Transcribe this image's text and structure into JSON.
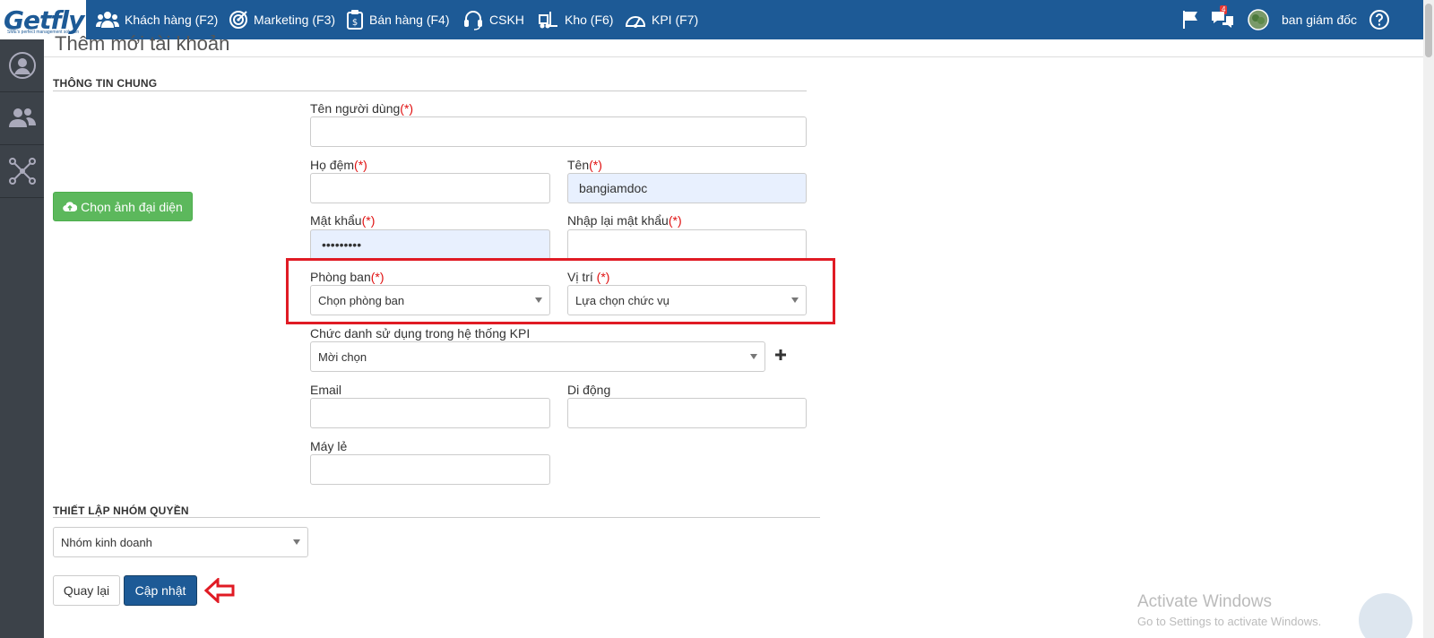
{
  "brand": {
    "name": "Getfly",
    "tagline": "SME's perfect management solution"
  },
  "nav": [
    {
      "label": "Khách hàng (F2)",
      "icon": "users-icon"
    },
    {
      "label": "Marketing (F3)",
      "icon": "target-icon"
    },
    {
      "label": "Bán hàng (F4)",
      "icon": "sales-icon"
    },
    {
      "label": "CSKH",
      "icon": "headset-icon"
    },
    {
      "label": "Kho (F6)",
      "icon": "forklift-icon"
    },
    {
      "label": "KPI (F7)",
      "icon": "speedometer-icon"
    }
  ],
  "user": {
    "name": "ban giám đốc",
    "notification_count": "4"
  },
  "page": {
    "title": "Thêm mới tài khoản"
  },
  "sections": {
    "general": "THÔNG TIN CHUNG",
    "permissions": "THIẾT LẬP NHÓM QUYỀN"
  },
  "form": {
    "required_mark": "(*)",
    "avatar_button": "Chọn ảnh đại diện",
    "username": {
      "label": "Tên người dùng",
      "value": ""
    },
    "middle_name": {
      "label": "Họ đệm",
      "value": ""
    },
    "first_name": {
      "label": "Tên",
      "value": "bangiamdoc"
    },
    "password": {
      "label": "Mật khẩu",
      "value": "•••••••••"
    },
    "confirm_password": {
      "label": "Nhập lại mật khẩu",
      "value": ""
    },
    "department": {
      "label": "Phòng ban",
      "value": "Chọn phòng ban"
    },
    "position": {
      "label": "Vị trí",
      "value": "Lựa chọn chức vụ"
    },
    "kpi_title": {
      "label": "Chức danh sử dụng trong hệ thống KPI",
      "value": "Mời chọn"
    },
    "email": {
      "label": "Email",
      "value": ""
    },
    "mobile": {
      "label": "Di động",
      "value": ""
    },
    "extension": {
      "label": "Máy lẻ",
      "value": ""
    },
    "permission_group": {
      "value": "Nhóm kinh doanh"
    }
  },
  "actions": {
    "back": "Quay lại",
    "update": "Cập nhật"
  },
  "watermark": {
    "line1": "Activate Windows",
    "line2": "Go to Settings to activate Windows."
  },
  "colors": {
    "nav": "#1d5a96",
    "sidebar": "#3c4249",
    "success": "#5cb85c",
    "highlight": "#e01b24"
  }
}
